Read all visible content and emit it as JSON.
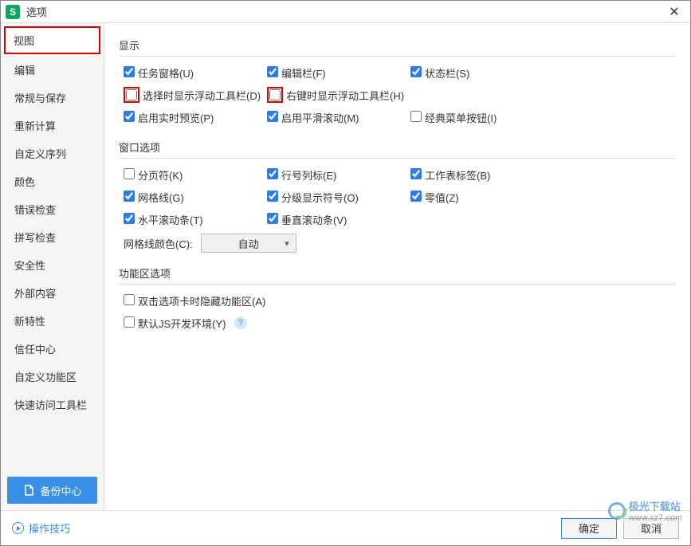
{
  "window": {
    "title": "选项"
  },
  "sidebar": {
    "items": [
      "视图",
      "编辑",
      "常规与保存",
      "重新计算",
      "自定义序列",
      "颜色",
      "错误检查",
      "拼写检查",
      "安全性",
      "外部内容",
      "新特性",
      "信任中心",
      "自定义功能区",
      "快速访问工具栏"
    ],
    "backup": "备份中心"
  },
  "sections": {
    "display": {
      "title": "显示",
      "opts": [
        {
          "label": "任务窗格(U)",
          "checked": true
        },
        {
          "label": "编辑栏(F)",
          "checked": true
        },
        {
          "label": "状态栏(S)",
          "checked": true
        },
        {
          "label": "选择时显示浮动工具栏(D)",
          "checked": false,
          "red": true
        },
        {
          "label": "右键时显示浮动工具栏(H)",
          "checked": false,
          "red": true
        },
        {
          "label": "",
          "empty": true
        },
        {
          "label": "启用实时预览(P)",
          "checked": true
        },
        {
          "label": "启用平滑滚动(M)",
          "checked": true
        },
        {
          "label": "经典菜单按钮(I)",
          "checked": false
        }
      ]
    },
    "windowOpts": {
      "title": "窗口选项",
      "opts": [
        {
          "label": "分页符(K)",
          "checked": false
        },
        {
          "label": "行号列标(E)",
          "checked": true
        },
        {
          "label": "工作表标签(B)",
          "checked": true
        },
        {
          "label": "网格线(G)",
          "checked": true
        },
        {
          "label": "分级显示符号(O)",
          "checked": true
        },
        {
          "label": "零值(Z)",
          "checked": true
        },
        {
          "label": "水平滚动条(T)",
          "checked": true
        },
        {
          "label": "垂直滚动条(V)",
          "checked": true
        }
      ],
      "gridColorLabel": "网格线颜色(C):",
      "gridColorValue": "自动"
    },
    "ribbon": {
      "title": "功能区选项",
      "opts": [
        {
          "label": "双击选项卡时隐藏功能区(A)",
          "checked": false
        },
        {
          "label": "默认JS开发环境(Y)",
          "checked": false,
          "help": true
        }
      ]
    }
  },
  "footer": {
    "tips": "操作技巧",
    "ok": "确定",
    "cancel": "取消"
  },
  "watermark": {
    "text1": "极光下载站",
    "text2": "www.xz7.com"
  }
}
